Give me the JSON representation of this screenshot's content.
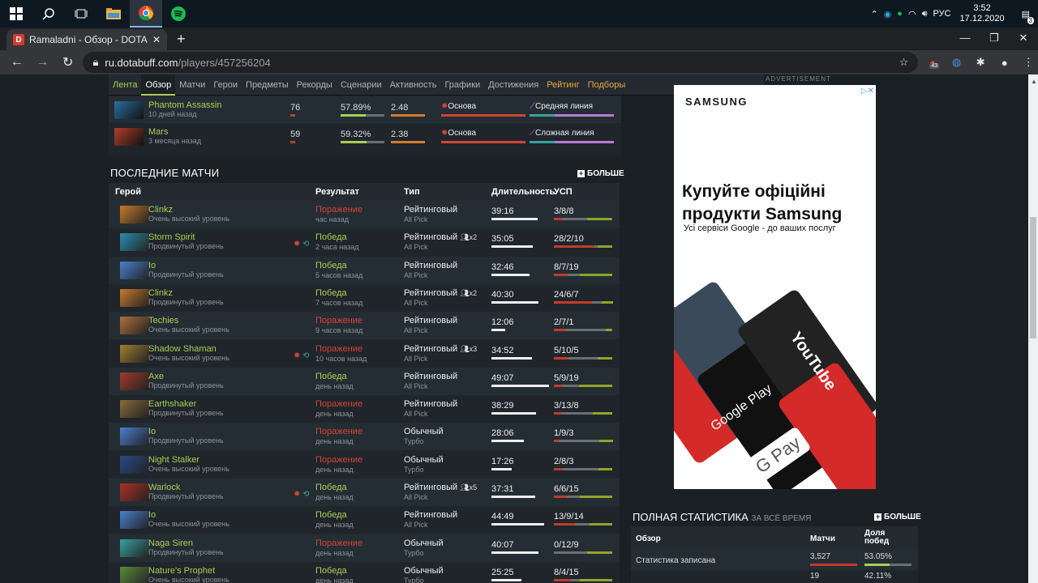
{
  "taskbar": {
    "lang": "РУС",
    "time": "3:52",
    "date": "17.12.2020",
    "notif_count": "3"
  },
  "browser": {
    "tab_title": "Ramaladni - Обзор - DOTABUFF",
    "url_host": "ru.dotabuff.com",
    "url_path": "/players/457256204",
    "ext_badge": "43"
  },
  "subnav": {
    "items": [
      "Лента",
      "Обзор",
      "Матчи",
      "Герои",
      "Предметы",
      "Рекорды",
      "Сценарии",
      "Активность",
      "Графики",
      "Достижения",
      "Рейтинг",
      "Подборы"
    ],
    "active": "Обзор"
  },
  "ad_label": "ADVERTISEMENT",
  "top_heroes": [
    {
      "name": "Phantom Assassin",
      "when": "10 дней назад",
      "matches": "76",
      "winrate": "57.89%",
      "kda": "2.48",
      "role": "Основа",
      "lane": "Средняя линия",
      "winrate_value": 0.5789,
      "kda_value": 2.48
    },
    {
      "name": "Mars",
      "when": "3 месяца назад",
      "matches": "59",
      "winrate": "59.32%",
      "kda": "2.38",
      "role": "Основа",
      "lane": "Сложная линия",
      "winrate_value": 0.5932,
      "kda_value": 2.38
    }
  ],
  "recent": {
    "title": "ПОСЛЕДНИЕ МАТЧИ",
    "more": "БОЛЬШЕ",
    "headers": {
      "hero": "Герой",
      "result": "Результат",
      "type": "Тип",
      "duration": "Длительность",
      "kda": "УСП"
    },
    "rows": [
      {
        "hero": "Clinkz",
        "skill": "Очень высокий уровень",
        "result": "Поражение",
        "win": false,
        "when": "час назад",
        "type": "Рейтинговый",
        "mode": "All Pick",
        "party": "",
        "duration": "39:16",
        "kda": "3/8/8",
        "k": 3,
        "d": 8,
        "a": 8,
        "color": "#c77a2a"
      },
      {
        "hero": "Storm Spirit",
        "skill": "Продвинутый уровень",
        "result": "Победа",
        "win": true,
        "when": "2 часа назад",
        "type": "Рейтинговый",
        "mode": "All Pick",
        "party": "x2",
        "duration": "35:05",
        "kda": "28/2/10",
        "k": 28,
        "d": 2,
        "a": 10,
        "color": "#2a8fb0",
        "items": true
      },
      {
        "hero": "Io",
        "skill": "Продвинутый уровень",
        "result": "Победа",
        "win": true,
        "when": "5 часов назад",
        "type": "Рейтинговый",
        "mode": "All Pick",
        "party": "",
        "duration": "32:46",
        "kda": "8/7/19",
        "k": 8,
        "d": 7,
        "a": 19,
        "color": "#4a7fd0"
      },
      {
        "hero": "Clinkz",
        "skill": "Продвинутый уровень",
        "result": "Победа",
        "win": true,
        "when": "7 часов назад",
        "type": "Рейтинговый",
        "mode": "All Pick",
        "party": "x2",
        "duration": "40:30",
        "kda": "24/6/7",
        "k": 24,
        "d": 6,
        "a": 7,
        "color": "#c77a2a"
      },
      {
        "hero": "Techies",
        "skill": "Очень высокий уровень",
        "result": "Поражение",
        "win": false,
        "when": "9 часов назад",
        "type": "Рейтинговый",
        "mode": "All Pick",
        "party": "",
        "duration": "12:06",
        "kda": "2/7/1",
        "k": 2,
        "d": 7,
        "a": 1,
        "color": "#b0703a"
      },
      {
        "hero": "Shadow Shaman",
        "skill": "Очень высокий уровень",
        "result": "Поражение",
        "win": false,
        "when": "10 часов назад",
        "type": "Рейтинговый",
        "mode": "All Pick",
        "party": "x3",
        "duration": "34:52",
        "kda": "5/10/5",
        "k": 5,
        "d": 10,
        "a": 5,
        "color": "#a08030",
        "items": true
      },
      {
        "hero": "Axe",
        "skill": "Продвинутый уровень",
        "result": "Победа",
        "win": true,
        "when": "день назад",
        "type": "Рейтинговый",
        "mode": "All Pick",
        "party": "",
        "duration": "49:07",
        "kda": "5/9/19",
        "k": 5,
        "d": 9,
        "a": 19,
        "color": "#a03a2a"
      },
      {
        "hero": "Earthshaker",
        "skill": "Продвинутый уровень",
        "result": "Поражение",
        "win": false,
        "when": "день назад",
        "type": "Рейтинговый",
        "mode": "All Pick",
        "party": "",
        "duration": "38:29",
        "kda": "3/13/8",
        "k": 3,
        "d": 13,
        "a": 8,
        "color": "#8a6a3a"
      },
      {
        "hero": "Io",
        "skill": "Продвинутый уровень",
        "result": "Поражение",
        "win": false,
        "when": "день назад",
        "type": "Обычный",
        "mode": "Турбо",
        "party": "",
        "duration": "28:06",
        "kda": "1/9/3",
        "k": 1,
        "d": 9,
        "a": 3,
        "color": "#4a7fd0"
      },
      {
        "hero": "Night Stalker",
        "skill": "Очень высокий уровень",
        "result": "Поражение",
        "win": false,
        "when": "день назад",
        "type": "Обычный",
        "mode": "Турбо",
        "party": "",
        "duration": "17:26",
        "kda": "2/8/3",
        "k": 2,
        "d": 8,
        "a": 3,
        "color": "#2a4a8a"
      },
      {
        "hero": "Warlock",
        "skill": "Продвинутый уровень",
        "result": "Победа",
        "win": true,
        "when": "день назад",
        "type": "Рейтинговый",
        "mode": "All Pick",
        "party": "x5",
        "duration": "37:31",
        "kda": "6/6/15",
        "k": 6,
        "d": 6,
        "a": 15,
        "color": "#b03020",
        "items": true
      },
      {
        "hero": "Io",
        "skill": "Очень высокий уровень",
        "result": "Победа",
        "win": true,
        "when": "день назад",
        "type": "Рейтинговый",
        "mode": "All Pick",
        "party": "",
        "duration": "44:49",
        "kda": "13/9/14",
        "k": 13,
        "d": 9,
        "a": 14,
        "color": "#4a7fd0"
      },
      {
        "hero": "Naga Siren",
        "skill": "Продвинутый уровень",
        "result": "Поражение",
        "win": false,
        "when": "день назад",
        "type": "Обычный",
        "mode": "Турбо",
        "party": "",
        "duration": "40:07",
        "kda": "0/12/9",
        "k": 0,
        "d": 12,
        "a": 9,
        "color": "#3aa0a0"
      },
      {
        "hero": "Nature's Prophet",
        "skill": "Очень высокий уровень",
        "result": "Победа",
        "win": true,
        "when": "день назад",
        "type": "Обычный",
        "mode": "Турбо",
        "party": "",
        "duration": "25:25",
        "kda": "8/4/15",
        "k": 8,
        "d": 4,
        "a": 15,
        "color": "#5a8a3a"
      }
    ]
  },
  "ad": {
    "brand": "SAMSUNG",
    "line1": "Купуйте офіційні",
    "line2": "продукти Samsung",
    "line3": "Усі сервіси Google - до ваших послуг",
    "gp": "Google Play",
    "yt": "YouTube",
    "gpay": "G Pay"
  },
  "stats": {
    "title": "ПОЛНАЯ СТАТИСТИКА",
    "subtitle": "ЗА ВСЁ ВРЕМЯ",
    "more": "БОЛЬШЕ",
    "h_overview": "Обзор",
    "h_matches": "Матчи",
    "h_win1": "Доля",
    "h_win2": "побед",
    "rows": [
      {
        "label": "Статистика записана",
        "matches": "3,527",
        "winrate": "53.05%"
      },
      {
        "label": "",
        "matches": "19",
        "winrate": "42.11%"
      }
    ]
  },
  "colors": {
    "win": "#a9cf54",
    "loss": "#d24432",
    "bg": "#1b2024"
  }
}
